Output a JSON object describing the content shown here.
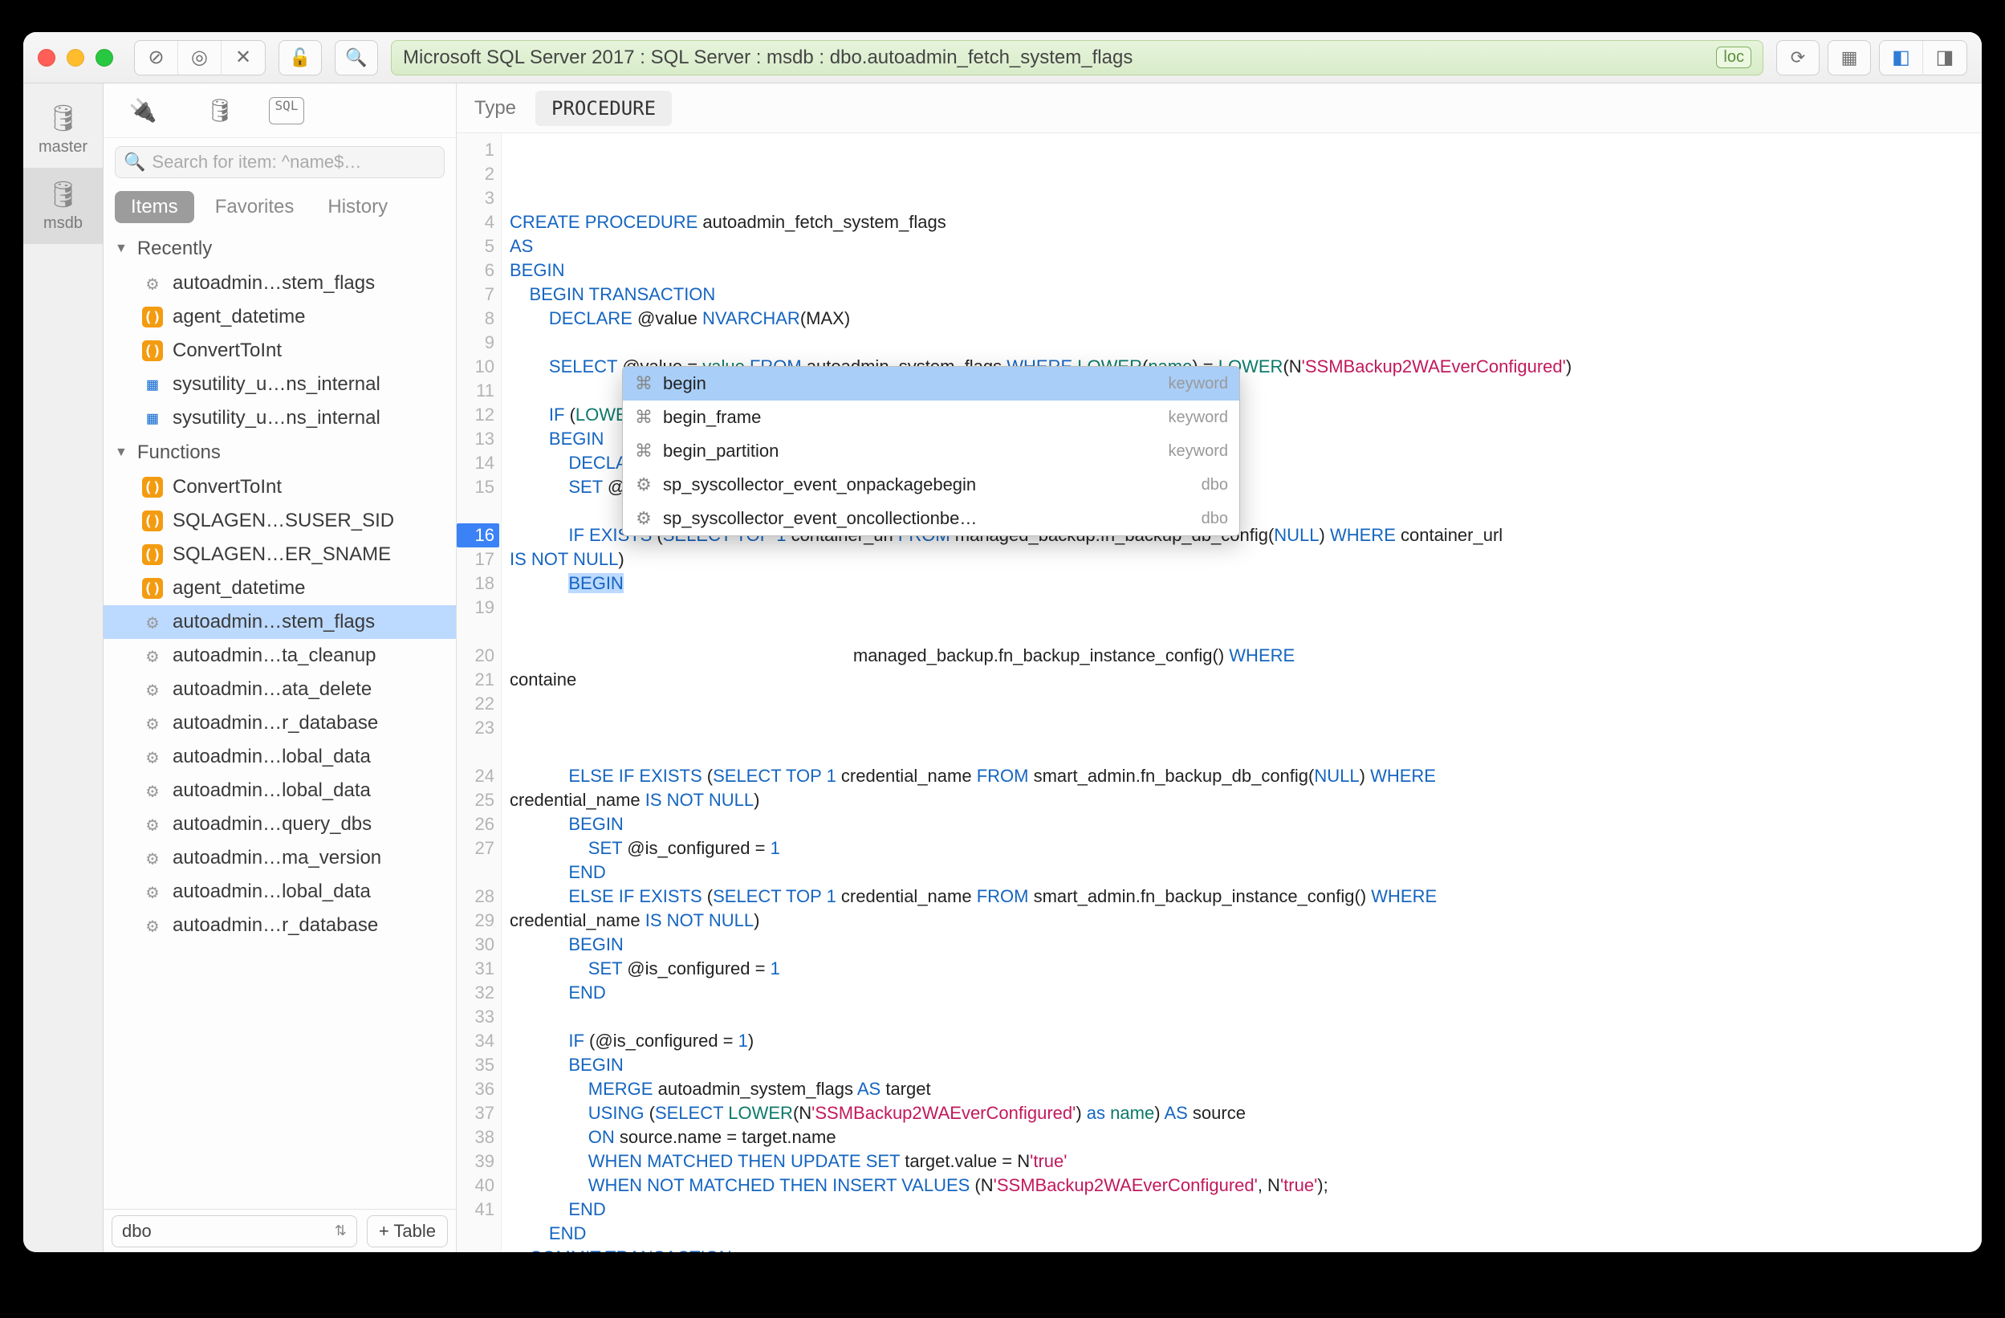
{
  "breadcrumb": "Microsoft SQL Server 2017 : SQL Server : msdb : dbo.autoadmin_fetch_system_flags",
  "breadcrumb_badge": "loc",
  "db_rail": [
    {
      "label": "master",
      "selected": false
    },
    {
      "label": "msdb",
      "selected": true
    }
  ],
  "sidebar": {
    "search_placeholder": "Search for item: ^name$…",
    "tabs": {
      "items_label": "Items",
      "favorites_label": "Favorites",
      "history_label": "History"
    },
    "sections": [
      {
        "title": "Recently",
        "items": [
          {
            "icon": "gear",
            "label": "autoadmin…stem_flags"
          },
          {
            "icon": "fn",
            "label": "agent_datetime"
          },
          {
            "icon": "fn",
            "label": "ConvertToInt"
          },
          {
            "icon": "grid",
            "label": "sysutility_u…ns_internal"
          },
          {
            "icon": "grid",
            "label": "sysutility_u…ns_internal"
          }
        ]
      },
      {
        "title": "Functions",
        "items": [
          {
            "icon": "fn",
            "label": "ConvertToInt"
          },
          {
            "icon": "fn",
            "label": "SQLAGEN…SUSER_SID"
          },
          {
            "icon": "fn",
            "label": "SQLAGEN…ER_SNAME"
          },
          {
            "icon": "fn",
            "label": "agent_datetime"
          },
          {
            "icon": "gear",
            "label": "autoadmin…stem_flags",
            "selected": true
          },
          {
            "icon": "gear",
            "label": "autoadmin…ta_cleanup"
          },
          {
            "icon": "gear",
            "label": "autoadmin…ata_delete"
          },
          {
            "icon": "gear",
            "label": "autoadmin…r_database"
          },
          {
            "icon": "gear",
            "label": "autoadmin…lobal_data"
          },
          {
            "icon": "gear",
            "label": "autoadmin…lobal_data"
          },
          {
            "icon": "gear",
            "label": "autoadmin…query_dbs"
          },
          {
            "icon": "gear",
            "label": "autoadmin…ma_version"
          },
          {
            "icon": "gear",
            "label": "autoadmin…lobal_data"
          },
          {
            "icon": "gear",
            "label": "autoadmin…r_database"
          }
        ]
      }
    ],
    "footer_schema": "dbo",
    "footer_button": "+ Table"
  },
  "main_header": {
    "type_label": "Type",
    "type_value": "PROCEDURE"
  },
  "editor": {
    "highlight_line": 16,
    "lines": [
      "",
      "<span class='kw'>CREATE PROCEDURE</span> autoadmin_fetch_system_flags",
      "<span class='kw'>AS</span>",
      "<span class='kw'>BEGIN</span>",
      "    <span class='kw'>BEGIN TRANSACTION</span>",
      "        <span class='kw'>DECLARE</span> @value <span class='kw'>NVARCHAR</span>(MAX)",
      "",
      "        <span class='kw'>SELECT</span> @value = <span class='fn'>value</span> <span class='kw'>FROM</span> autoadmin_system_flags <span class='kw'>WHERE</span> <span class='fn'>LOWER</span>(<span class='fn'>name</span>) = <span class='fn'>LOWER</span>(N<span class='str'>'SSMBackup2WAEverConfigured'</span>)",
      "",
      "        <span class='kw'>IF</span> (<span class='fn'>LOWER</span>(<span class='fn'>ISNULL</span>(@value, <span class='str'>''</span>)) &lt;&gt; N<span class='str'>'true'</span>)",
      "        <span class='kw'>BEGIN</span>",
      "            <span class='kw'>DECLARE</span> @is_configured <span class='kw'>BIT</span>",
      "            <span class='kw'>SET</span> @is_configured = <span class='num'>0</span>",
      "",
      "            <span class='kw'>IF EXISTS</span> (<span class='kw'>SELECT</span> <span class='kw'>TOP</span> <span class='num'>1</span> container_url <span class='kw'>FROM</span> managed_backup.fn_backup_db_config(<span class='kw'>NULL</span>) <span class='kw'>WHERE</span> container_url\n<span class='kw'>IS NOT NULL</span>)",
      "            <span class='kw sel'>BEGIN</span>",
      "",
      "",
      "                                                                      managed_backup.fn_backup_instance_config() <span class='kw'>WHERE</span>\ncontaine",
      "",
      "",
      "",
      "            <span class='kw'>ELSE IF EXISTS</span> (<span class='kw'>SELECT</span> <span class='kw'>TOP</span> <span class='num'>1</span> credential_name <span class='kw'>FROM</span> smart_admin.fn_backup_db_config(<span class='kw'>NULL</span>) <span class='kw'>WHERE</span>\ncredential_name <span class='kw'>IS NOT NULL</span>)",
      "            <span class='kw'>BEGIN</span>",
      "                <span class='kw'>SET</span> @is_configured = <span class='num'>1</span>",
      "            <span class='kw'>END</span>",
      "            <span class='kw'>ELSE IF EXISTS</span> (<span class='kw'>SELECT</span> <span class='kw'>TOP</span> <span class='num'>1</span> credential_name <span class='kw'>FROM</span> smart_admin.fn_backup_instance_config() <span class='kw'>WHERE</span>\ncredential_name <span class='kw'>IS NOT NULL</span>)",
      "            <span class='kw'>BEGIN</span>",
      "                <span class='kw'>SET</span> @is_configured = <span class='num'>1</span>",
      "            <span class='kw'>END</span>",
      "",
      "            <span class='kw'>IF</span> (@is_configured = <span class='num'>1</span>)",
      "            <span class='kw'>BEGIN</span>",
      "                <span class='kw'>MERGE</span> autoadmin_system_flags <span class='kw'>AS</span> target",
      "                <span class='kw'>USING</span> (<span class='kw'>SELECT</span> <span class='fn'>LOWER</span>(N<span class='str'>'SSMBackup2WAEverConfigured'</span>) <span class='kw'>as</span> <span class='fn'>name</span>) <span class='kw'>AS</span> source",
      "                <span class='kw'>ON</span> source.name = target.name",
      "                <span class='kw'>WHEN MATCHED THEN UPDATE SET</span> target.value = N<span class='str'>'true'</span>",
      "                <span class='kw'>WHEN NOT MATCHED THEN INSERT VALUES</span> (N<span class='str'>'SSMBackup2WAEverConfigured'</span>, N<span class='str'>'true'</span>);",
      "            <span class='kw'>END</span>",
      "        <span class='kw'>END</span>",
      "    <span class='kw'>COMMIT TRANSACTION</span>"
    ]
  },
  "autocomplete": [
    {
      "icon": "⌘",
      "label": "begin",
      "kind": "keyword",
      "selected": true
    },
    {
      "icon": "⌘",
      "label": "begin_frame",
      "kind": "keyword"
    },
    {
      "icon": "⌘",
      "label": "begin_partition",
      "kind": "keyword"
    },
    {
      "icon": "⚙",
      "label": "sp_syscollector_event_onpackagebegin",
      "kind": "dbo"
    },
    {
      "icon": "⚙",
      "label": "sp_syscollector_event_oncollectionbe…",
      "kind": "dbo"
    }
  ]
}
